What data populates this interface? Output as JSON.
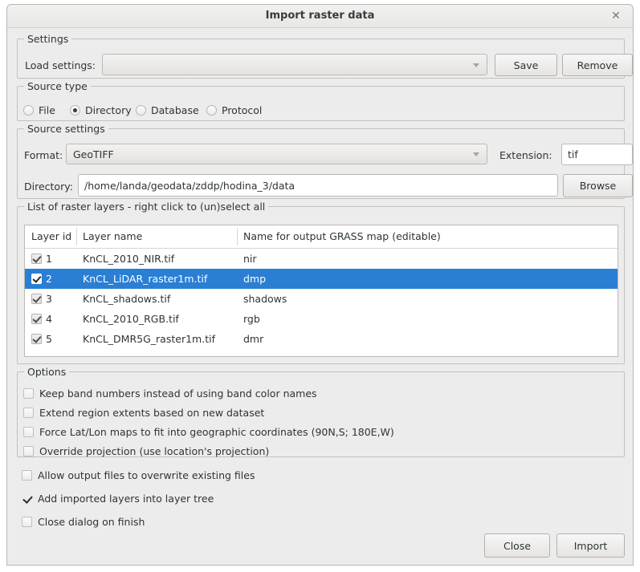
{
  "window": {
    "title": "Import raster data",
    "close_icon": "close-icon",
    "close_glyph": "✕"
  },
  "settings": {
    "legend": "Settings",
    "load_label": "Load settings:",
    "load_value": "",
    "load_placeholder": "",
    "save_label": "Save",
    "remove_label": "Remove"
  },
  "source_type": {
    "legend": "Source type",
    "options": [
      {
        "label": "File",
        "checked": false
      },
      {
        "label": "Directory",
        "checked": true
      },
      {
        "label": "Database",
        "checked": false
      },
      {
        "label": "Protocol",
        "checked": false
      }
    ]
  },
  "source_settings": {
    "legend": "Source settings",
    "format_label": "Format:",
    "format_value": "GeoTIFF",
    "extension_label": "Extension:",
    "extension_value": "tif",
    "directory_label": "Directory:",
    "directory_value": "/home/landa/geodata/zddp/hodina_3/data",
    "browse_label": "Browse"
  },
  "layers": {
    "legend": "List of raster layers - right click to (un)select all",
    "columns": [
      "Layer id",
      "Layer name",
      "Name for output GRASS map (editable)"
    ],
    "rows": [
      {
        "checked": true,
        "id": "1",
        "name": "KnCL_2010_NIR.tif",
        "output": "nir",
        "selected": false
      },
      {
        "checked": true,
        "id": "2",
        "name": "KnCL_LiDAR_raster1m.tif",
        "output": "dmp",
        "selected": true
      },
      {
        "checked": true,
        "id": "3",
        "name": "KnCL_shadows.tif",
        "output": "shadows",
        "selected": false
      },
      {
        "checked": true,
        "id": "4",
        "name": "KnCL_2010_RGB.tif",
        "output": "rgb",
        "selected": false
      },
      {
        "checked": true,
        "id": "5",
        "name": "KnCL_DMR5G_raster1m.tif",
        "output": "dmr",
        "selected": false
      }
    ],
    "selection_color": "#2a7fd4"
  },
  "options": {
    "legend": "Options",
    "items": [
      {
        "label": "Keep band numbers instead of using band color names",
        "checked": false
      },
      {
        "label": "Extend region extents based on new dataset",
        "checked": false
      },
      {
        "label": "Force Lat/Lon maps to fit into geographic coordinates (90N,S; 180E,W)",
        "checked": false
      },
      {
        "label": "Override projection (use location's projection)",
        "checked": false
      }
    ]
  },
  "extra_options": [
    {
      "label": "Allow output files to overwrite existing files",
      "checked": false
    },
    {
      "label": "Add imported layers into layer tree",
      "checked": true
    },
    {
      "label": "Close dialog on finish",
      "checked": false
    }
  ],
  "footer": {
    "close_label": "Close",
    "import_label": "Import"
  }
}
